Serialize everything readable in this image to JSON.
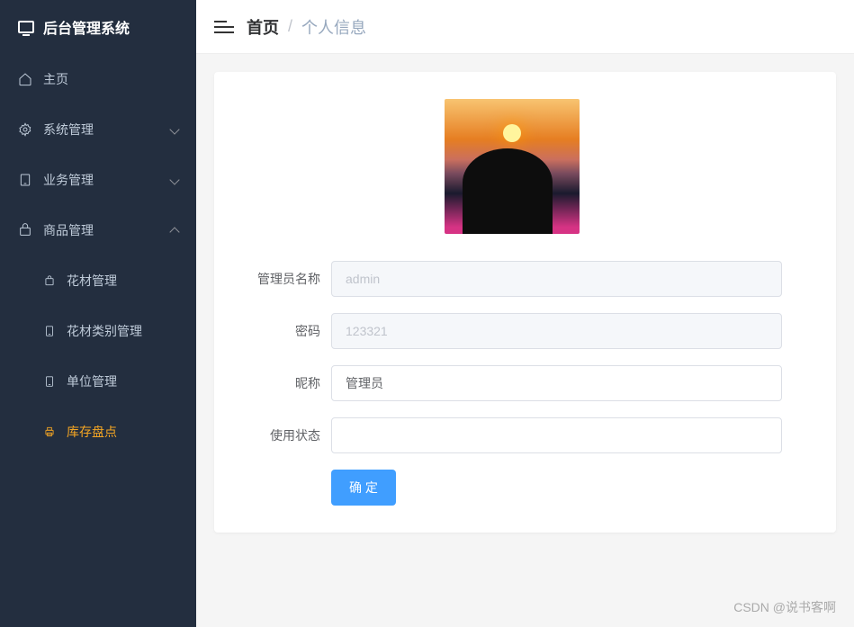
{
  "logo_title": "后台管理系统",
  "sidebar": {
    "items": [
      {
        "label": "主页",
        "icon": "home"
      },
      {
        "label": "系统管理",
        "icon": "gear",
        "expandable": true
      },
      {
        "label": "业务管理",
        "icon": "tablet",
        "expandable": true
      },
      {
        "label": "商品管理",
        "icon": "goods",
        "expandable": true,
        "expanded": true
      }
    ],
    "submenu": [
      {
        "label": "花材管理"
      },
      {
        "label": "花材类别管理"
      },
      {
        "label": "单位管理"
      },
      {
        "label": "库存盘点",
        "active": true
      }
    ]
  },
  "breadcrumb": {
    "home": "首页",
    "separator": "/",
    "current": "个人信息"
  },
  "form": {
    "fields": [
      {
        "label": "管理员名称",
        "value": "admin",
        "disabled": true
      },
      {
        "label": "密码",
        "value": "123321",
        "disabled": true
      },
      {
        "label": "昵称",
        "value": "管理员",
        "disabled": false
      },
      {
        "label": "使用状态",
        "value": "",
        "disabled": false
      }
    ],
    "submit_label": "确 定"
  },
  "watermark": "CSDN @说书客啊"
}
